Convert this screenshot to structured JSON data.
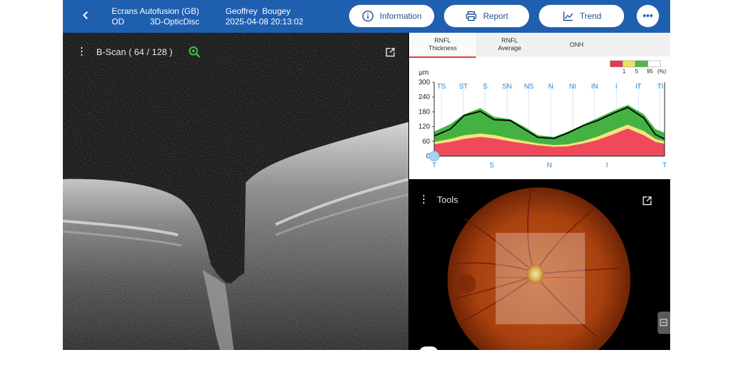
{
  "header": {
    "back_icon": "chevron-left-icon",
    "device_name": "Ecrans Autofusion (GB)",
    "eye": "OD",
    "scan_type": "3D-OpticDisc",
    "patient_first": "Geoffrey",
    "patient_last": "Bougey",
    "datetime": "2025-04-08 20:13:02",
    "buttons": {
      "information": "Information",
      "report": "Report",
      "trend": "Trend"
    },
    "more_label": "•••"
  },
  "bscan": {
    "title": "B-Scan ( 64 / 128 )"
  },
  "rnfl": {
    "tabs": [
      {
        "line1": "RNFL",
        "line2": "Thickness"
      },
      {
        "line1": "RNFL",
        "line2": "Average"
      },
      {
        "line1": "ONH",
        "line2": ""
      }
    ],
    "legend": {
      "labels": [
        "1",
        "5",
        "95",
        "(%)"
      ],
      "colors": [
        "#e53950",
        "#f0e060",
        "#4cb84c",
        "#ffffff"
      ]
    }
  },
  "chart_data": {
    "type": "area",
    "ylabel": "μm",
    "ylim": [
      0,
      300
    ],
    "yticks": [
      0,
      60,
      120,
      180,
      240,
      300
    ],
    "sectors": [
      "TS",
      "ST",
      "S",
      "SN",
      "NS",
      "N",
      "NI",
      "IN",
      "I",
      "IT",
      "TI"
    ],
    "x_bottom_labels": [
      "T",
      "S",
      "N",
      "I",
      "T"
    ],
    "x": [
      0,
      0.07,
      0.13,
      0.2,
      0.26,
      0.33,
      0.39,
      0.45,
      0.52,
      0.58,
      0.65,
      0.71,
      0.78,
      0.84,
      0.91,
      0.96,
      1.0
    ],
    "series": [
      {
        "values": [
          48,
          58,
          70,
          78,
          72,
          60,
          52,
          44,
          38,
          40,
          52,
          66,
          90,
          112,
          85,
          58,
          50
        ]
      },
      {
        "values": [
          58,
          70,
          85,
          92,
          86,
          72,
          62,
          52,
          45,
          48,
          62,
          80,
          106,
          128,
          102,
          70,
          60
        ]
      },
      {
        "values": [
          100,
          130,
          170,
          195,
          160,
          150,
          120,
          85,
          78,
          100,
          130,
          155,
          185,
          208,
          170,
          110,
          95
        ]
      },
      {
        "values": [
          82,
          110,
          165,
          182,
          148,
          145,
          110,
          76,
          72,
          94,
          125,
          145,
          175,
          198,
          155,
          88,
          70
        ]
      }
    ],
    "colors": [
      "#ee4a5c",
      "#f2e47a",
      "#44b243",
      "#000000"
    ]
  },
  "tools": {
    "title": "Tools"
  },
  "icons": {
    "zoom": "zoom-in-icon",
    "expand": "open-in-new-icon",
    "kebab": "more-vert-icon"
  }
}
